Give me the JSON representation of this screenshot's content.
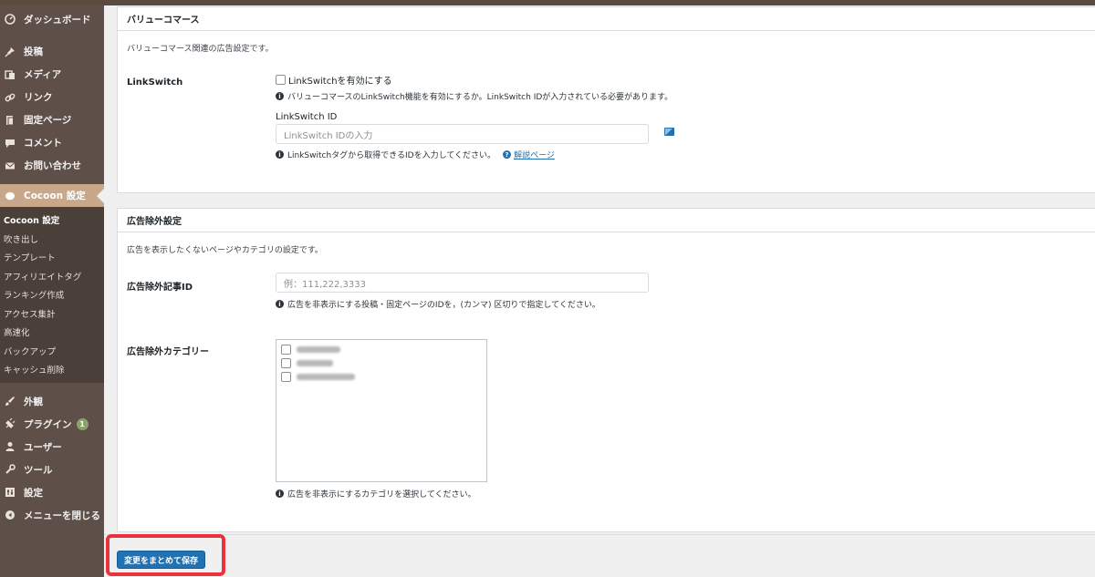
{
  "sidebar": {
    "items_top": [
      {
        "label": "ダッシュボード",
        "icon": "dashboard-icon"
      },
      {
        "label": "投稿",
        "icon": "pin-icon"
      },
      {
        "label": "メディア",
        "icon": "media-icon"
      },
      {
        "label": "リンク",
        "icon": "link-icon"
      },
      {
        "label": "固定ページ",
        "icon": "page-icon"
      },
      {
        "label": "コメント",
        "icon": "comment-icon"
      },
      {
        "label": "お問い合わせ",
        "icon": "mail-icon"
      }
    ],
    "active_item": {
      "label": "Cocoon 設定",
      "icon": "cocoon-icon"
    },
    "submenu": [
      "Cocoon 設定",
      "吹き出し",
      "テンプレート",
      "アフィリエイトタグ",
      "ランキング作成",
      "アクセス集計",
      "高速化",
      "バックアップ",
      "キャッシュ削除"
    ],
    "items_bottom": [
      {
        "label": "外観",
        "icon": "brush-icon"
      },
      {
        "label": "プラグイン",
        "icon": "plugin-icon",
        "badge": "1"
      },
      {
        "label": "ユーザー",
        "icon": "user-icon"
      },
      {
        "label": "ツール",
        "icon": "wrench-icon"
      },
      {
        "label": "設定",
        "icon": "settings-icon"
      },
      {
        "label": "メニューを閉じる",
        "icon": "collapse-icon"
      }
    ]
  },
  "valuecommerce": {
    "title": "バリューコマース",
    "description": "バリューコマース関連の広告設定です。",
    "linkswitch_label": "LinkSwitch",
    "checkbox_label": "LinkSwitchを有効にする",
    "checkbox_info": "バリューコマースのLinkSwitch機能を有効にするか。LinkSwitch IDが入力されている必要があります。",
    "id_label": "LinkSwitch ID",
    "id_placeholder": "LinkSwitch IDの入力",
    "id_info": "LinkSwitchタグから取得できるIDを入力してください。",
    "help_link": "解説ページ"
  },
  "ad_exclusion": {
    "title": "広告除外設定",
    "description": "広告を表示したくないページやカテゴリの設定です。",
    "article_id_label": "広告除外記事ID",
    "article_id_placeholder": "例：111,222,3333",
    "article_id_info": "広告を非表示にする投稿・固定ページのIDを，(カンマ) 区切りで指定してください。",
    "category_label": "広告除外カテゴリー",
    "category_info": "広告を非表示にするカテゴリを選択してください。"
  },
  "save_button": "変更をまとめて保存",
  "colors": {
    "accent": "#2271b1",
    "sidebar": "#5e5049",
    "active": "#c8a78b",
    "highlight": "#e8323c"
  }
}
